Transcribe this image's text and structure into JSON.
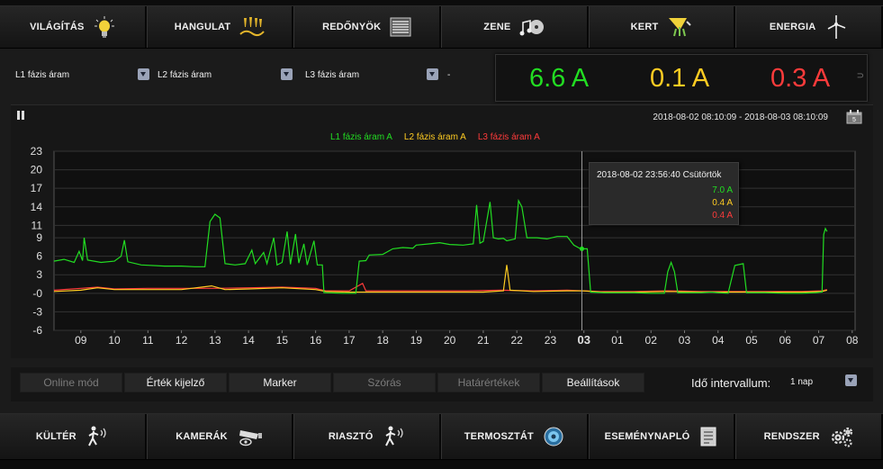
{
  "top_nav": [
    {
      "label": "VILÁGÍTÁS",
      "icon": "lightbulb-icon"
    },
    {
      "label": "HANGULAT",
      "icon": "mood-lights-icon"
    },
    {
      "label": "REDŐNYÖK",
      "icon": "blinds-icon"
    },
    {
      "label": "ZENE",
      "icon": "music-icon"
    },
    {
      "label": "KERT",
      "icon": "garden-icon"
    },
    {
      "label": "ENERGIA",
      "icon": "wind-turbine-icon"
    }
  ],
  "selectors": [
    {
      "label": "L1 fázis áram"
    },
    {
      "label": "L2 fázis áram"
    },
    {
      "label": "L3 fázis áram"
    },
    {
      "label": "-"
    }
  ],
  "current_values": [
    {
      "text": "6.6 A",
      "color": "#22dd22"
    },
    {
      "text": "0.1 A",
      "color": "#ffcc22"
    },
    {
      "text": "0.3 A",
      "color": "#ff3b3b"
    }
  ],
  "time_range": "2018-08-02 08:10:09 - 2018-08-03 08:10:09",
  "tooltip": {
    "title": "2018-08-02 23:56:40 Csütörtök",
    "values": [
      {
        "text": "7.0 A",
        "color": "#22dd22"
      },
      {
        "text": "0.4 A",
        "color": "#ffcc22"
      },
      {
        "text": "0.4 A",
        "color": "#ff3b3b"
      }
    ]
  },
  "chart_data": {
    "type": "line",
    "x_ticks": [
      "09",
      "10",
      "11",
      "12",
      "13",
      "14",
      "15",
      "16",
      "17",
      "18",
      "19",
      "20",
      "21",
      "22",
      "23",
      "03",
      "01",
      "02",
      "03",
      "04",
      "05",
      "06",
      "07",
      "08"
    ],
    "y_ticks": [
      23,
      20,
      17,
      14,
      11,
      9,
      6,
      3,
      0,
      -3,
      -6
    ],
    "ylim": [
      -6,
      23
    ],
    "grid": true,
    "legend_position": "top-center",
    "crosshair_hour": 23.94,
    "series": [
      {
        "name": "L1 fázis áram A",
        "color": "#22dd22",
        "points": [
          [
            8.2,
            5.2
          ],
          [
            8.5,
            5.5
          ],
          [
            8.8,
            5.0
          ],
          [
            8.95,
            6.8
          ],
          [
            9.05,
            5.3
          ],
          [
            9.1,
            9.0
          ],
          [
            9.2,
            5.4
          ],
          [
            9.6,
            5.0
          ],
          [
            10.0,
            5.2
          ],
          [
            10.2,
            6.0
          ],
          [
            10.3,
            8.6
          ],
          [
            10.4,
            5.1
          ],
          [
            10.8,
            4.6
          ],
          [
            11.5,
            4.4
          ],
          [
            12.0,
            4.4
          ],
          [
            12.4,
            4.3
          ],
          [
            12.7,
            4.3
          ],
          [
            12.85,
            11.6
          ],
          [
            13.0,
            12.8
          ],
          [
            13.15,
            12.2
          ],
          [
            13.3,
            4.8
          ],
          [
            13.6,
            4.6
          ],
          [
            13.9,
            4.8
          ],
          [
            14.1,
            7.0
          ],
          [
            14.2,
            4.8
          ],
          [
            14.45,
            6.6
          ],
          [
            14.55,
            4.8
          ],
          [
            14.75,
            9.0
          ],
          [
            14.85,
            4.6
          ],
          [
            15.0,
            5.0
          ],
          [
            15.15,
            10.0
          ],
          [
            15.25,
            4.7
          ],
          [
            15.4,
            9.6
          ],
          [
            15.5,
            4.9
          ],
          [
            15.65,
            8.0
          ],
          [
            15.75,
            4.6
          ],
          [
            15.95,
            8.5
          ],
          [
            16.05,
            4.6
          ],
          [
            16.2,
            4.6
          ],
          [
            16.25,
            0.1
          ],
          [
            16.8,
            0.0
          ],
          [
            17.2,
            0.0
          ],
          [
            17.3,
            5.2
          ],
          [
            17.5,
            5.3
          ],
          [
            17.6,
            6.2
          ],
          [
            18.0,
            6.3
          ],
          [
            18.3,
            7.2
          ],
          [
            18.6,
            7.4
          ],
          [
            18.9,
            7.3
          ],
          [
            19.0,
            7.8
          ],
          [
            19.4,
            8.0
          ],
          [
            19.7,
            8.2
          ],
          [
            20.0,
            7.9
          ],
          [
            20.4,
            7.8
          ],
          [
            20.7,
            8.0
          ],
          [
            20.8,
            14.3
          ],
          [
            20.9,
            8.1
          ],
          [
            21.0,
            8.4
          ],
          [
            21.2,
            14.8
          ],
          [
            21.3,
            9.0
          ],
          [
            21.45,
            8.8
          ],
          [
            21.6,
            8.9
          ],
          [
            21.7,
            8.5
          ],
          [
            21.95,
            8.8
          ],
          [
            22.05,
            15.0
          ],
          [
            22.15,
            14.0
          ],
          [
            22.3,
            9.0
          ],
          [
            22.6,
            9.0
          ],
          [
            22.9,
            8.8
          ],
          [
            23.2,
            9.2
          ],
          [
            23.5,
            9.2
          ],
          [
            23.7,
            7.8
          ],
          [
            23.9,
            7.2
          ],
          [
            24.1,
            7.2
          ],
          [
            24.2,
            0.2
          ],
          [
            24.6,
            0.1
          ],
          [
            25.0,
            0.1
          ],
          [
            25.5,
            0.1
          ],
          [
            26.0,
            0.0
          ],
          [
            26.4,
            0.0
          ],
          [
            26.5,
            3.5
          ],
          [
            26.6,
            5.0
          ],
          [
            26.7,
            3.5
          ],
          [
            26.8,
            0.1
          ],
          [
            27.5,
            0.1
          ],
          [
            27.8,
            0.2
          ],
          [
            28.0,
            0.1
          ],
          [
            28.3,
            0.0
          ],
          [
            28.5,
            4.5
          ],
          [
            28.75,
            4.8
          ],
          [
            28.85,
            0.1
          ],
          [
            29.4,
            0.1
          ],
          [
            30.0,
            0.0
          ],
          [
            30.5,
            0.0
          ],
          [
            30.9,
            0.1
          ],
          [
            31.1,
            0.2
          ],
          [
            31.15,
            9.5
          ],
          [
            31.2,
            10.5
          ],
          [
            31.25,
            10.0
          ]
        ]
      },
      {
        "name": "L2 fázis áram A",
        "color": "#ffcc22",
        "points": [
          [
            8.2,
            0.3
          ],
          [
            9.0,
            0.5
          ],
          [
            9.5,
            0.9
          ],
          [
            10.0,
            0.6
          ],
          [
            11.0,
            0.6
          ],
          [
            12.0,
            0.6
          ],
          [
            12.9,
            1.2
          ],
          [
            13.3,
            0.6
          ],
          [
            14.0,
            0.7
          ],
          [
            15.0,
            0.9
          ],
          [
            16.0,
            0.6
          ],
          [
            16.3,
            0.3
          ],
          [
            17.0,
            0.2
          ],
          [
            18.0,
            0.2
          ],
          [
            19.0,
            0.2
          ],
          [
            20.0,
            0.2
          ],
          [
            21.0,
            0.2
          ],
          [
            21.6,
            0.4
          ],
          [
            21.7,
            4.6
          ],
          [
            21.8,
            0.5
          ],
          [
            22.5,
            0.3
          ],
          [
            23.5,
            0.4
          ],
          [
            24.0,
            0.4
          ],
          [
            24.5,
            0.2
          ],
          [
            25.5,
            0.2
          ],
          [
            26.5,
            0.3
          ],
          [
            27.5,
            0.2
          ],
          [
            28.5,
            0.2
          ],
          [
            29.5,
            0.2
          ],
          [
            30.5,
            0.2
          ],
          [
            31.1,
            0.3
          ],
          [
            31.25,
            0.5
          ]
        ]
      },
      {
        "name": "L3 fázis áram A",
        "color": "#ff3b3b",
        "points": [
          [
            8.2,
            0.5
          ],
          [
            9.0,
            0.8
          ],
          [
            9.5,
            1.0
          ],
          [
            10.0,
            0.7
          ],
          [
            11.0,
            0.8
          ],
          [
            12.0,
            0.8
          ],
          [
            13.0,
            0.8
          ],
          [
            14.0,
            0.9
          ],
          [
            15.0,
            1.0
          ],
          [
            16.0,
            0.8
          ],
          [
            16.3,
            0.4
          ],
          [
            17.0,
            0.4
          ],
          [
            17.4,
            1.6
          ],
          [
            17.5,
            0.4
          ],
          [
            18.5,
            0.4
          ],
          [
            19.5,
            0.4
          ],
          [
            20.5,
            0.4
          ],
          [
            21.5,
            0.5
          ],
          [
            22.5,
            0.4
          ],
          [
            23.5,
            0.5
          ],
          [
            24.0,
            0.4
          ],
          [
            24.5,
            0.3
          ],
          [
            25.5,
            0.3
          ],
          [
            26.5,
            0.4
          ],
          [
            27.5,
            0.3
          ],
          [
            28.5,
            0.3
          ],
          [
            29.5,
            0.3
          ],
          [
            30.5,
            0.3
          ],
          [
            31.1,
            0.4
          ],
          [
            31.25,
            0.6
          ]
        ]
      }
    ]
  },
  "toolbar": [
    {
      "label": "Online mód",
      "active": false
    },
    {
      "label": "Érték kijelző",
      "active": true
    },
    {
      "label": "Marker",
      "active": true
    },
    {
      "label": "Szórás",
      "active": false
    },
    {
      "label": "Határértékek",
      "active": false
    },
    {
      "label": "Beállítások",
      "active": true
    }
  ],
  "interval": {
    "label": "Idő intervallum:",
    "value": "1 nap"
  },
  "bottom_nav": [
    {
      "label": "KÜLTÉR",
      "icon": "outdoor-motion-icon"
    },
    {
      "label": "KAMERÁK",
      "icon": "camera-icon"
    },
    {
      "label": "RIASZTÓ",
      "icon": "alarm-icon"
    },
    {
      "label": "TERMOSZTÁT",
      "icon": "thermostat-icon"
    },
    {
      "label": "ESEMÉNYNAPLÓ",
      "icon": "event-log-icon"
    },
    {
      "label": "RENDSZER",
      "icon": "gears-icon"
    }
  ]
}
